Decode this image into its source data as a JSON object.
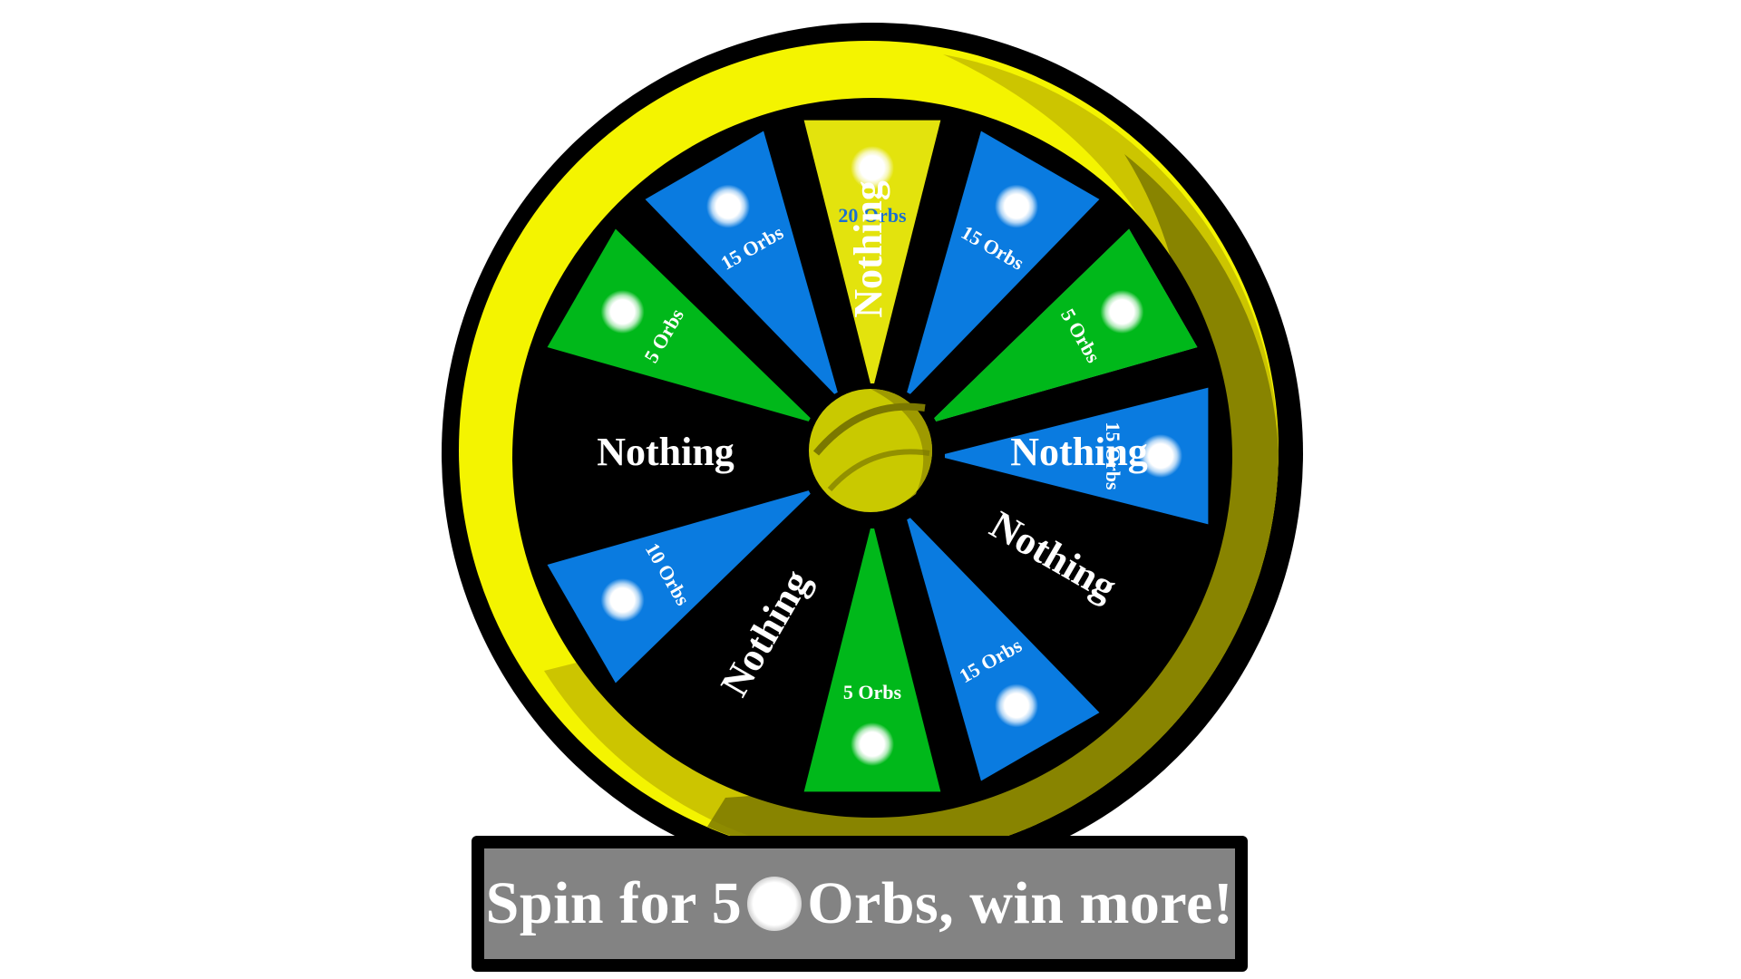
{
  "wheel": {
    "segments": [
      {
        "label": "20 Orbs",
        "fill": "#e3e30d",
        "text_color": "#1c6fd0",
        "type": "prize",
        "angle": 0
      },
      {
        "label": "Nothing",
        "fill": "#000000",
        "text_color": "#ffffff",
        "type": "nothing",
        "angle": 30
      },
      {
        "label": "5 Orbs",
        "fill": "#77e284",
        "text_color": "#ffffff",
        "type": "prize",
        "angle": 60
      },
      {
        "label": "15 Orbs",
        "fill": "#0a7be0",
        "text_color": "#ffffff",
        "type": "prize",
        "angle": 90
      },
      {
        "label": "Nothing",
        "fill": "#000000",
        "text_color": "#ffffff",
        "type": "nothing",
        "angle": 120
      },
      {
        "label": "15 Orbs",
        "fill": "#0a7be0",
        "text_color": "#ffffff",
        "type": "prize",
        "angle": 150
      },
      {
        "label": "5 Orbs",
        "fill": "#00b81a",
        "text_color": "#ffffff",
        "type": "prize",
        "angle": 180
      },
      {
        "label": "Nothing",
        "fill": "#000000",
        "text_color": "#ffffff",
        "type": "nothing",
        "angle": 210
      },
      {
        "label": "10 Orbs",
        "fill": "#0a7be0",
        "text_color": "#ffffff",
        "type": "prize",
        "angle": 240
      },
      {
        "label": "Nothing",
        "fill": "#000000",
        "text_color": "#ffffff",
        "type": "nothing",
        "angle": 270
      },
      {
        "label": "5 Orbs",
        "fill": "#00b81a",
        "text_color": "#ffffff",
        "type": "prize",
        "angle": 300
      },
      {
        "label": "15 Orbs",
        "fill": "#0a7be0",
        "text_color": "#ffffff",
        "type": "prize",
        "angle": 330
      },
      {
        "label": "Nothing",
        "fill": "#000000",
        "text_color": "#ffffff",
        "type": "nothing",
        "angle": 360
      },
      {
        "label": "15 Orbs",
        "fill": "#0a7be0",
        "text_color": "#ffffff",
        "type": "prize",
        "angle": 390
      },
      {
        "label": "5 Orbs",
        "fill": "#00b81a",
        "text_color": "#ffffff",
        "type": "prize",
        "angle": 420
      },
      {
        "label": "Nothing",
        "fill": "#000000",
        "text_color": "#ffffff",
        "type": "nothing",
        "angle": 450
      }
    ],
    "colors": {
      "rim_yellow": "#f4f400",
      "rim_olive": "#c8c000",
      "rim_dark": "#7b7800",
      "hub": "#c9c900",
      "face": "#000000"
    },
    "icons": {
      "orb": "white-orb-icon",
      "hub": "wheel-hub-icon"
    }
  },
  "banner": {
    "text_before": "Spin for 5",
    "text_after": "Orbs, win more!",
    "background": "#838383"
  }
}
